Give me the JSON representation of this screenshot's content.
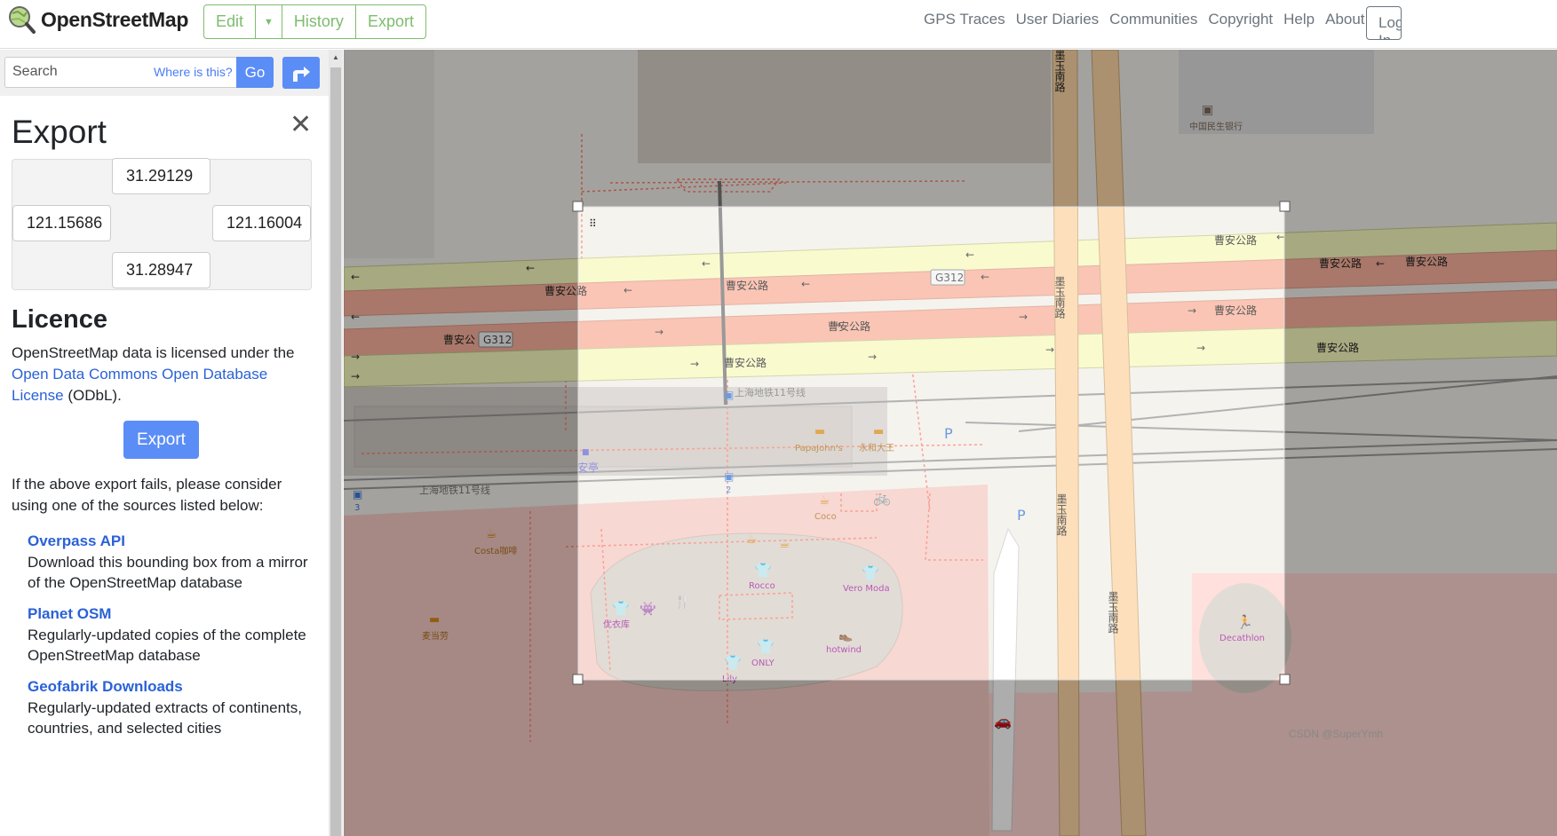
{
  "header": {
    "logo_text": "OpenStreetMap",
    "edit_label": "Edit",
    "history_label": "History",
    "export_label": "Export",
    "nav": [
      "GPS Traces",
      "User Diaries",
      "Communities",
      "Copyright",
      "Help",
      "About"
    ],
    "login_label": "Log In"
  },
  "search": {
    "placeholder": "Search",
    "where_label": "Where is this?",
    "go_label": "Go"
  },
  "export_panel": {
    "title": "Export",
    "north": "31.29129",
    "west": "121.15686",
    "east": "121.16004",
    "south": "31.28947",
    "licence_title": "Licence",
    "licence_pre": "OpenStreetMap data is licensed under the ",
    "licence_link": "Open Data Commons Open Database License",
    "licence_post": " (ODbL).",
    "export_button": "Export",
    "fail_text": "If the above export fails, please consider using one of the sources listed below:",
    "sources": [
      {
        "name": "Overpass API",
        "desc": "Download this bounding box from a mirror of the OpenStreetMap database"
      },
      {
        "name": "Planet OSM",
        "desc": "Regularly-updated copies of the complete OpenStreetMap database"
      },
      {
        "name": "Geofabrik Downloads",
        "desc": "Regularly-updated extracts of continents, countries, and selected cities"
      }
    ]
  },
  "map": {
    "road_labels": [
      "曹安公路",
      "曹安公路",
      "曹安公路",
      "曹安公路",
      "曹安公路",
      "曹安公路",
      "曹安公路",
      "曹安公路",
      "曹安公路",
      "曹安公"
    ],
    "route_refs": [
      "G312",
      "G312"
    ],
    "vertical_road_labels": [
      "墨玉南路",
      "墨玉南路",
      "墨玉南路",
      "墨玉南路",
      "墨玉路"
    ],
    "metro_labels": [
      "上海地铁11号线",
      "上海地铁11号线"
    ],
    "poi_labels": {
      "bank": "中国民生银行",
      "papajohns": "PapaJohn's",
      "yonghe": "永和大王",
      "coco": "Coco",
      "costa": "Costa咖啡",
      "mcd": "麦当劳",
      "rocco": "Rocco",
      "veromoda": "Vero Moda",
      "uniqlo": "优衣库",
      "only": "ONLY",
      "hotwind": "hotwind",
      "lily": "Lily",
      "decathlon": "Decathlon",
      "station": "安亭",
      "metro_exit_2": "2",
      "metro_exit_3": "3"
    },
    "watermark": "CSDN @SuperYmh"
  },
  "colors": {
    "osm_green": "#7ebc6f",
    "button_blue": "#5b8df7",
    "link_blue": "#2a62d6",
    "trunk_road": "#f9b29c",
    "primary_road": "#fcd6a4",
    "secondary_road": "#f7fabf",
    "retail_area": "#ffd6d1"
  }
}
